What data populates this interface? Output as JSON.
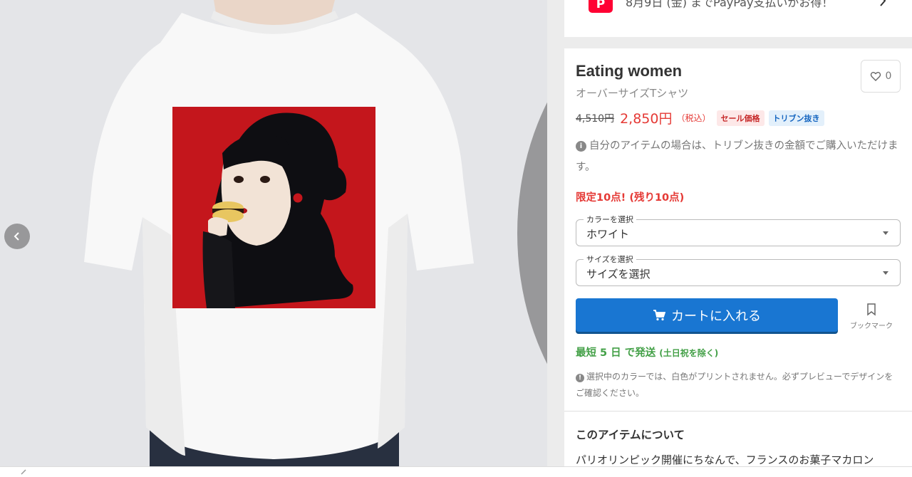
{
  "gallery": {
    "prev_icon": "chevron-left-icon",
    "next_icon": "chevron-right-icon"
  },
  "promo": {
    "logo_text": "P",
    "text": "8月9日 (金) までPayPay支払いがお得！",
    "icon": "chevron-right-icon"
  },
  "product": {
    "title": "Eating women",
    "subtitle": "オーバーサイズTシャツ",
    "like_count": "0",
    "original_price": "4,510円",
    "sale_price": "2,850円",
    "tax_label": "（税込）",
    "badge_sale": "セール価格",
    "badge_tribune": "トリブン抜き",
    "info_note": "自分のアイテムの場合は、トリブン抜きの金額でご購入いただけます。",
    "limited": "限定10点! (残り10点)"
  },
  "options": {
    "color_label": "カラーを選択",
    "color_value": "ホワイト",
    "size_label": "サイズを選択",
    "size_value": "サイズを選択"
  },
  "actions": {
    "cart_label": "カートに入れる",
    "bookmark_label": "ブックマーク"
  },
  "shipping": {
    "main": "最短 5 日 で発送",
    "note": "(土日祝を除く)"
  },
  "warning": "選択中のカラーでは、白色がプリントされません。必ずプレビューでデザインをご確認ください。",
  "about": {
    "heading": "このアイテムについて",
    "text": "パリオリンピック開催にちなんで、フランスのお菓子マカロン"
  },
  "colors": {
    "accent_blue": "#1976d2",
    "sale_red": "#e53935",
    "ship_green": "#43a047",
    "art_red": "#c4161c"
  }
}
